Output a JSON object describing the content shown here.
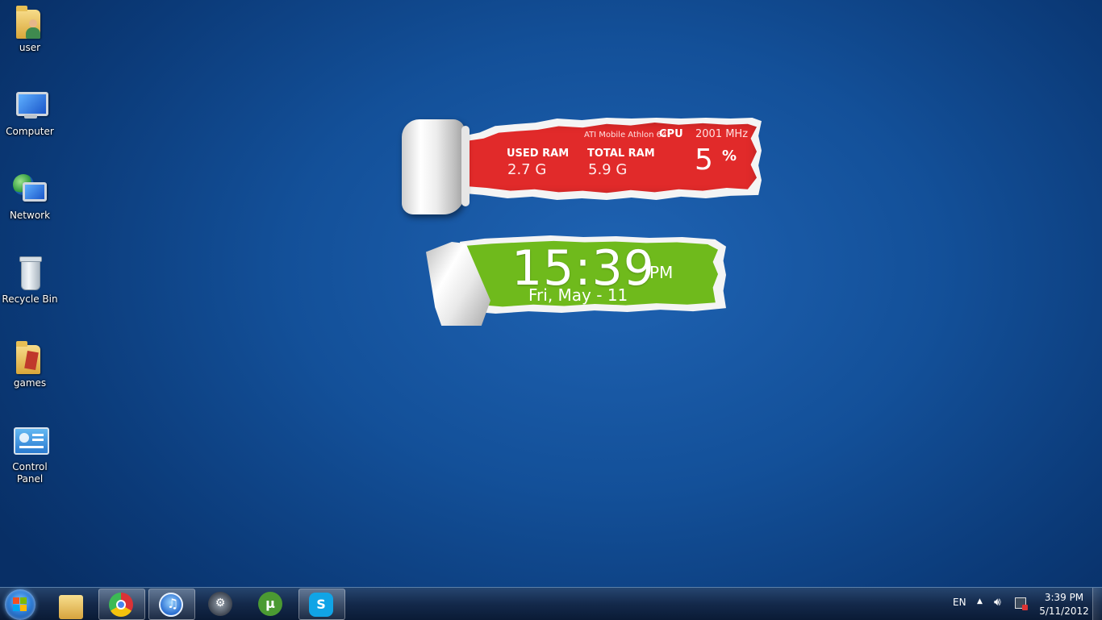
{
  "desktop_icons": [
    {
      "label": "user",
      "icon": "user-folder-icon"
    },
    {
      "label": "Computer",
      "icon": "computer-icon"
    },
    {
      "label": "Network",
      "icon": "network-icon"
    },
    {
      "label": "Recycle Bin",
      "icon": "recycle-bin-icon"
    },
    {
      "label": "games",
      "icon": "folder-icon"
    },
    {
      "label": "Control Panel",
      "icon": "control-panel-icon"
    }
  ],
  "system_gadget": {
    "cpu_name": "ATI Mobile Athlon 64",
    "cpu_label": "CPU",
    "cpu_freq": "2001 MHz",
    "used_ram_label": "USED RAM",
    "used_ram_value": "2.7 G",
    "total_ram_label": "TOTAL RAM",
    "total_ram_value": "5.9 G",
    "cpu_usage_value": "5",
    "cpu_usage_unit": "%",
    "accent": "#e12a2a"
  },
  "clock_gadget": {
    "time": "15:39",
    "ampm": "PM",
    "date": "Fri, May - 11",
    "accent": "#6fba1c"
  },
  "taskbar": {
    "start_icon": "windows-start-icon",
    "pinned": [
      {
        "name": "Windows Explorer",
        "icon": "folder-icon",
        "active": false
      },
      {
        "name": "Google Chrome",
        "icon": "chrome-icon",
        "active": true
      },
      {
        "name": "iTunes",
        "icon": "itunes-icon",
        "active": true
      },
      {
        "name": "Steam",
        "icon": "steam-icon",
        "active": false
      },
      {
        "name": "uTorrent",
        "icon": "utorrent-icon",
        "active": false
      },
      {
        "name": "Skype",
        "icon": "skype-icon",
        "active": true
      }
    ],
    "tray": {
      "language": "EN",
      "clock_time": "3:39 PM",
      "clock_date": "5/11/2012"
    }
  }
}
